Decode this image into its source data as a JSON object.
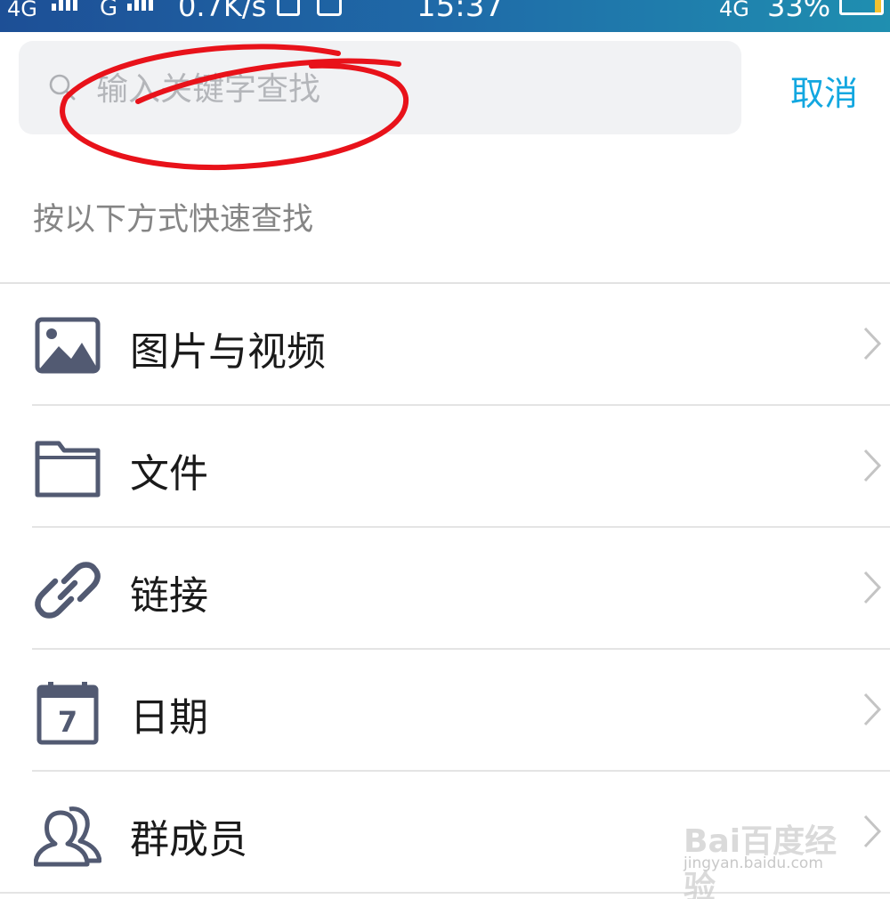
{
  "status_bar": {
    "network1": "4G",
    "network2": "G",
    "speed": "0.7K/s",
    "time": "15:37",
    "network3": "4G",
    "battery": "33%"
  },
  "search": {
    "placeholder": "输入关键字查找",
    "cancel_label": "取消"
  },
  "hint": "按以下方式快速查找",
  "list": [
    {
      "label": "图片与视频",
      "icon": "image-icon"
    },
    {
      "label": "文件",
      "icon": "folder-icon"
    },
    {
      "label": "链接",
      "icon": "link-icon"
    },
    {
      "label": "日期",
      "icon": "calendar-icon",
      "icon_text": "7"
    },
    {
      "label": "群成员",
      "icon": "group-members-icon"
    }
  ],
  "watermark": {
    "logo": "Bai百度经验",
    "url": "jingyan.baidu.com"
  },
  "colors": {
    "accent": "#12a7e0",
    "icon": "#525a72",
    "annotation": "#e8121a",
    "status_bar": "#1f6aa8"
  }
}
